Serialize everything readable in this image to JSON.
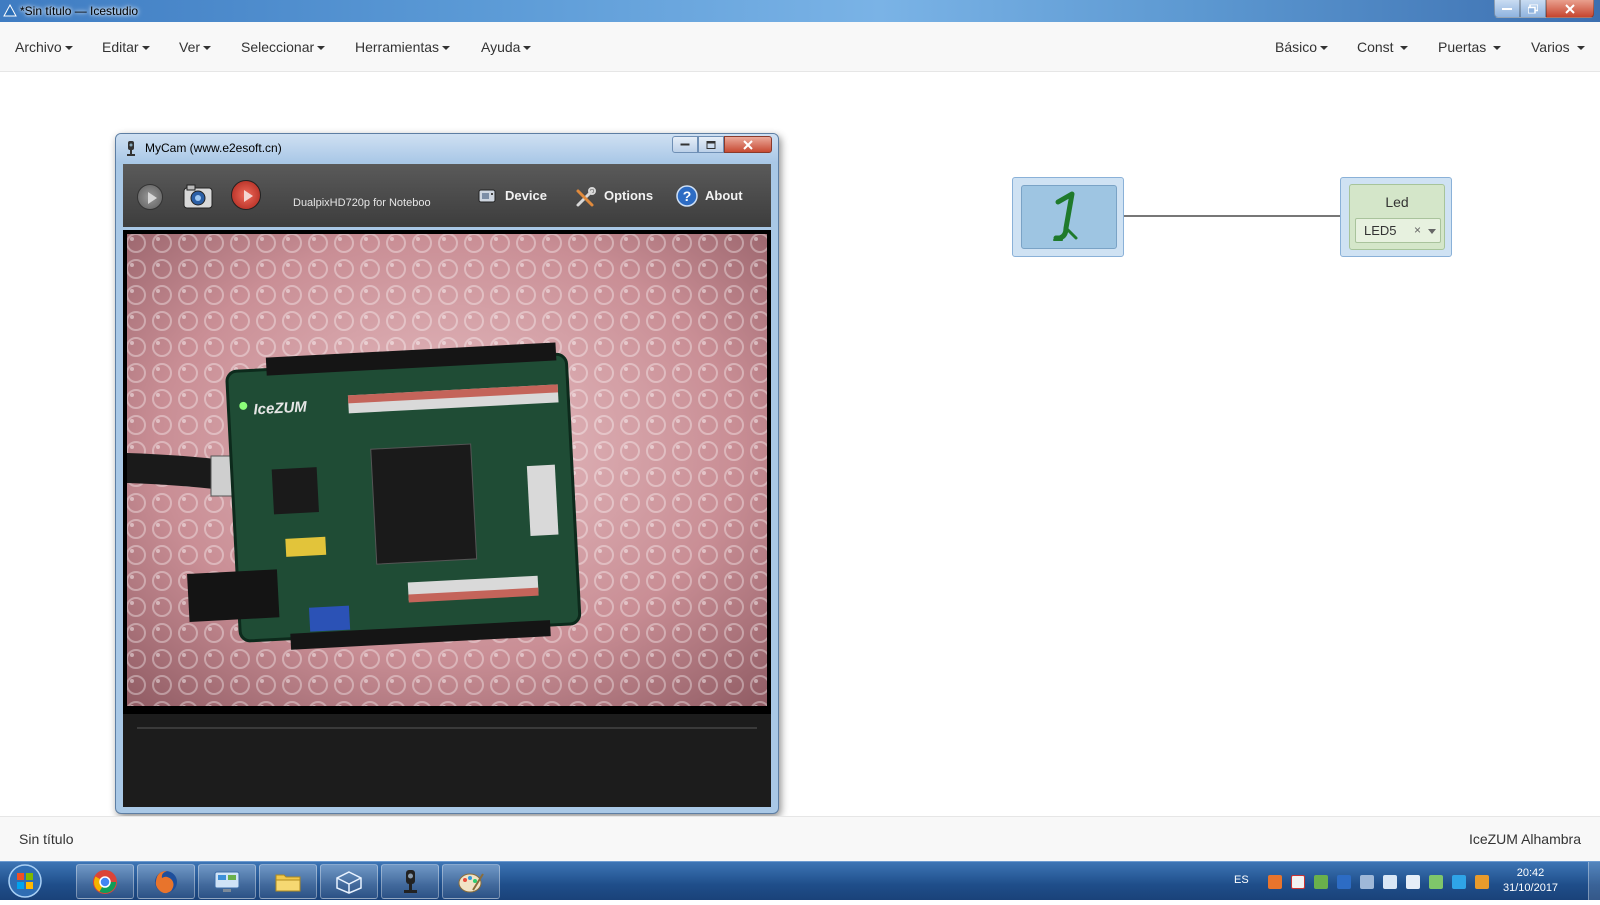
{
  "window": {
    "title": "*Sin título — Icestudio"
  },
  "menubar": {
    "left": [
      {
        "label": "Archivo"
      },
      {
        "label": "Editar"
      },
      {
        "label": "Ver"
      },
      {
        "label": "Seleccionar"
      },
      {
        "label": "Herramientas"
      },
      {
        "label": "Ayuda"
      }
    ],
    "right": [
      {
        "label": "Básico"
      },
      {
        "label": "Const"
      },
      {
        "label": "Puertas"
      },
      {
        "label": "Varios"
      }
    ]
  },
  "canvas": {
    "input_block": {
      "icon": "constant-one-icon",
      "value_glyph": "1",
      "color": "#9ec5e2"
    },
    "output_block": {
      "title": "Led",
      "selected": "LED5",
      "clear_glyph": "×",
      "color": "#d4e6c9"
    },
    "wire_color": "#777777"
  },
  "mycam": {
    "title": "MyCam (www.e2esoft.cn)",
    "device_name": "DualpixHD720p for Noteboo",
    "buttons": {
      "device": "Device",
      "options": "Options",
      "about": "About"
    },
    "video_subject": "IceZUM Alhambra FPGA board on bubble wrap"
  },
  "statusbar": {
    "left": "Sin título",
    "right": "IceZUM Alhambra"
  },
  "taskbar": {
    "apps": [
      "chrome-icon",
      "firefox-icon",
      "control-panel-icon",
      "file-explorer-icon",
      "3d-viewer-icon",
      "mycam-icon",
      "paint-icon"
    ],
    "language": "ES",
    "time": "20:42",
    "date": "31/10/2017"
  }
}
